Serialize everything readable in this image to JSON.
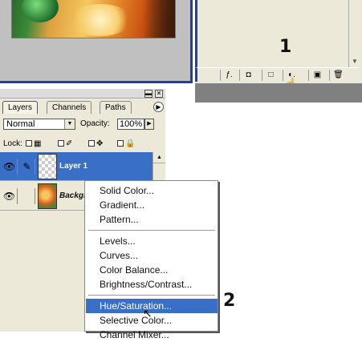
{
  "image_window": {
    "scroll_arrow": "▼"
  },
  "palette_bottom": {
    "buttons": [
      {
        "label": "ƒ.",
        "name": "layer-style"
      },
      {
        "label": "◘",
        "name": "add-mask"
      },
      {
        "label": "□",
        "name": "new-set"
      },
      {
        "label": "◐.",
        "name": "new-adjustment-layer"
      },
      {
        "label": "▣",
        "name": "new-layer"
      },
      {
        "label": "🗑",
        "name": "delete-layer"
      }
    ]
  },
  "annotations": {
    "step1": "1",
    "step2": "2"
  },
  "layers_panel": {
    "tabs": [
      "Layers",
      "Channels",
      "Paths"
    ],
    "tab_menu_arrow": "▶",
    "blend_mode": "Normal",
    "opacity_label": "Opacity:",
    "opacity_value": "100%",
    "lock_label": "Lock:",
    "lock_icons": {
      "transparency": "▦",
      "image": "✐",
      "position": "✥",
      "all": "🔒"
    },
    "layers": [
      {
        "name": "Layer 1",
        "selected": true
      },
      {
        "name": "Backgr",
        "selected": false
      }
    ]
  },
  "context_menu": {
    "group1": [
      "Solid Color...",
      "Gradient...",
      "Pattern..."
    ],
    "group2": [
      "Levels...",
      "Curves...",
      "Color Balance...",
      "Brightness/Contrast..."
    ],
    "group3": [
      "Hue/Saturation...",
      "Selective Color...",
      "Channel Mixer..."
    ]
  },
  "colors": {
    "accent": "#3a6fc8",
    "window_border": "#1c3fb0",
    "panel_bg": "#ece9d8"
  }
}
